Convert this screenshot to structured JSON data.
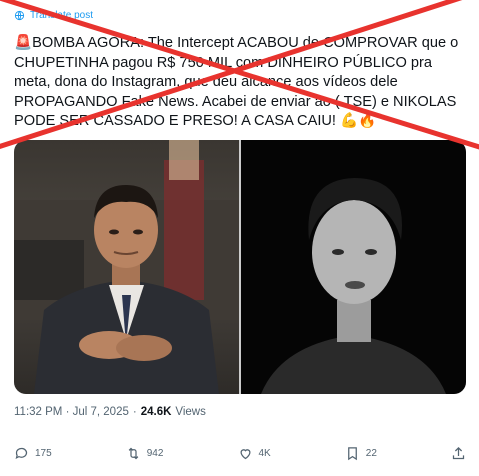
{
  "tweet": {
    "translate_label": "Translate post",
    "siren_emoji": "🚨",
    "text": "BOMBA AGORA: The Intercept ACABOU de COMPROVAR que o CHUPETINHA pagou R$ 750 MIL com DINHEIRO PÚBLICO pra meta, dona do Instagram, que deu alcance aos vídeos dele PROPAGANDO Fake News. Acabei de enviar ao ( TSE) e NIKOLAS PODE SER CASSADO E PRESO! A CASA CAIU! 💪🔥",
    "time": "11:32 PM · Jul 7, 2025",
    "separator": "·",
    "views_count": "24.6K",
    "views_label": "Views"
  },
  "actions": {
    "replies": "175",
    "reposts": "942",
    "likes": "4K",
    "bookmarks": "22"
  },
  "overlay": {
    "cross_color": "#e8332e"
  },
  "media": {
    "left_photo": "man-in-suit-photo",
    "right_photo": "man-speaking-black-background-photo"
  }
}
